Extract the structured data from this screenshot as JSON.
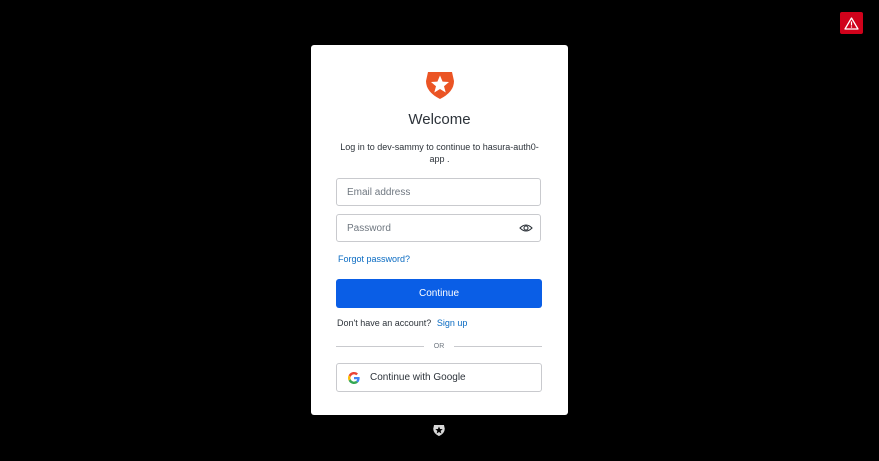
{
  "alert": {
    "icon": "warning-icon",
    "color": "#d0021b"
  },
  "card": {
    "logo_icon": "auth0-star-logo",
    "brand_color": "#eb5424",
    "title": "Welcome",
    "subtitle": "Log in to dev-sammy to continue to hasura-auth0-app ."
  },
  "form": {
    "email_placeholder": "Email address",
    "email_value": "",
    "password_placeholder": "Password",
    "password_value": "",
    "password_toggle_icon": "eye-icon",
    "forgot_password": "Forgot password?",
    "continue_label": "Continue",
    "accent_color": "#0a5ee6"
  },
  "signup": {
    "prompt": "Don't have an account?",
    "link": "Sign up"
  },
  "divider": {
    "label": "OR"
  },
  "social": {
    "google_label": "Continue with Google",
    "google_icon": "google-icon"
  },
  "footer": {
    "icon": "auth0-footer-logo"
  }
}
